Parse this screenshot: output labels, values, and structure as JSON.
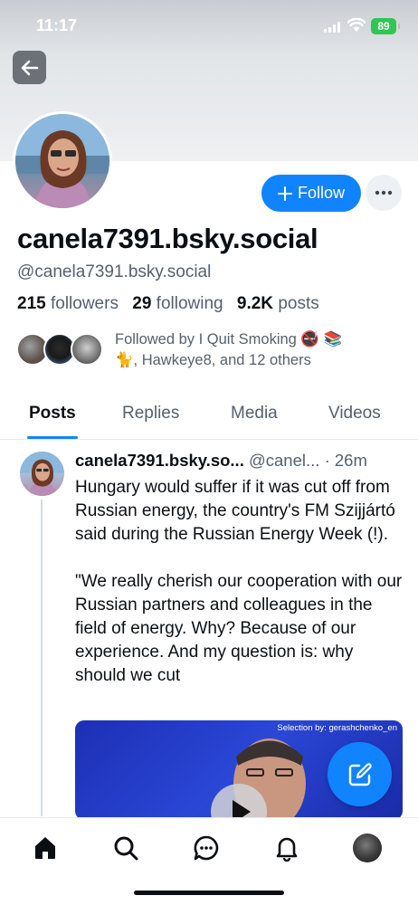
{
  "status_bar": {
    "time": "11:17",
    "battery": "89"
  },
  "profile": {
    "display_name": "canela7391.bsky.social",
    "handle": "@canela7391.bsky.social",
    "follow_label": "Follow",
    "followers_count": "215",
    "followers_label": "followers",
    "following_count": "29",
    "following_label": "following",
    "posts_count": "9.2K",
    "posts_label": "posts",
    "followed_by_line1": "Followed by I Quit Smoking 🚭 📚",
    "followed_by_line2": "🐈, Hawkeye8, and 12 others"
  },
  "tabs": [
    {
      "label": "Posts",
      "active": true
    },
    {
      "label": "Replies",
      "active": false
    },
    {
      "label": "Media",
      "active": false
    },
    {
      "label": "Videos",
      "active": false
    }
  ],
  "post": {
    "author_name": "canela7391.bsky.so...",
    "author_handle": "@canel...",
    "separator": "·",
    "time": "26m",
    "text": "Hungary would suffer if it was cut off from Russian energy, the country's FM Szijjártó said during the Russian Energy Week (!).\n\n\"We really cherish our cooperation with our Russian partners and colleagues in the field of energy. Why? Because of our experience. And my question is: why should we cut",
    "video_caption": "Selection by: gerashchenko_en"
  },
  "icons": {
    "back": "arrow-left-icon",
    "more": "ellipsis-icon",
    "plus": "plus-icon",
    "compose": "compose-icon",
    "home": "home-icon",
    "search": "search-icon",
    "chat": "chat-icon",
    "notifications": "bell-icon",
    "play": "play-icon"
  },
  "colors": {
    "accent": "#1083fe",
    "muted": "#55606e",
    "text": "#0b0f14"
  }
}
